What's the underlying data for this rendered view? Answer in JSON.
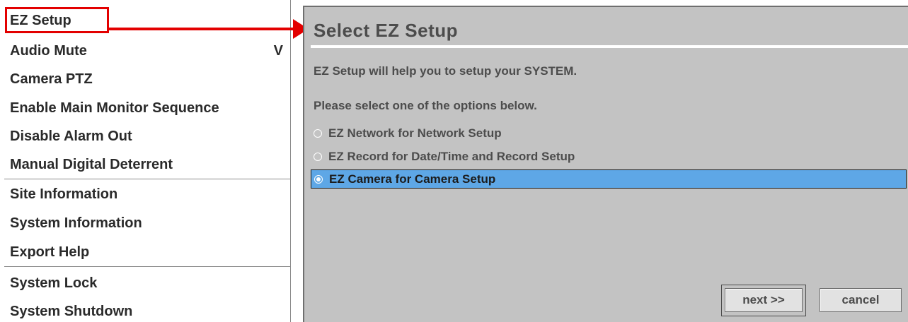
{
  "menu": {
    "items": [
      {
        "label": "EZ Setup",
        "check": ""
      },
      {
        "label": "Audio Mute",
        "check": "V"
      },
      {
        "label": "Camera PTZ",
        "check": ""
      },
      {
        "label": "Enable Main Monitor Sequence",
        "check": ""
      },
      {
        "label": "Disable Alarm Out",
        "check": ""
      },
      {
        "label": "Manual Digital Deterrent",
        "check": ""
      },
      {
        "label": "Site Information",
        "check": ""
      },
      {
        "label": "System Information",
        "check": ""
      },
      {
        "label": "Export Help",
        "check": ""
      },
      {
        "label": "System Lock",
        "check": ""
      },
      {
        "label": "System Shutdown",
        "check": ""
      }
    ]
  },
  "annotation": {
    "color": "#e30000"
  },
  "dialog": {
    "title": "Select EZ Setup",
    "intro": "EZ Setup will help you to setup your SYSTEM.",
    "instruction": "Please select one of the options below.",
    "options": [
      {
        "label": "EZ Network for Network Setup",
        "selected": false
      },
      {
        "label": "EZ Record for Date/Time and Record Setup",
        "selected": false
      },
      {
        "label": "EZ Camera for Camera Setup",
        "selected": true
      }
    ],
    "next_label": "next >>",
    "cancel_label": "cancel",
    "selected_color": "#5ea7e6"
  }
}
